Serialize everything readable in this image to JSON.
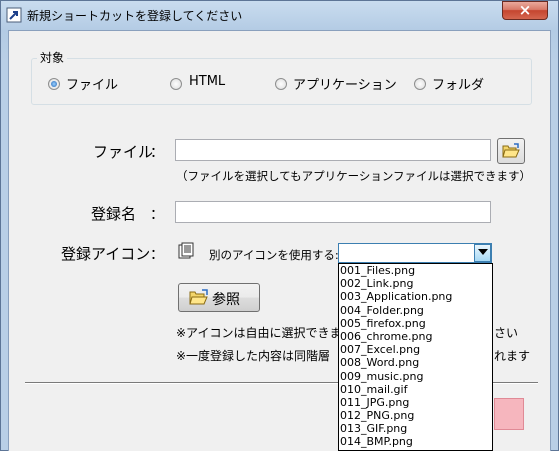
{
  "window": {
    "title": "新規ショートカットを登録してください",
    "close_label": "×"
  },
  "target_group": {
    "legend": "対象",
    "options": [
      {
        "label": "ファイル",
        "checked": true
      },
      {
        "label": "HTML",
        "checked": false
      },
      {
        "label": "アプリケーション",
        "checked": false
      },
      {
        "label": "フォルダ",
        "checked": false
      }
    ]
  },
  "file_field": {
    "label": "ファイル",
    "colon": "：",
    "value": "",
    "hint": "（ファイルを選択してもアプリケーションファイルは選択できます）"
  },
  "name_field": {
    "label": "登録名",
    "colon": "：",
    "value": ""
  },
  "icon_field": {
    "label": "登録アイコン",
    "colon": "：",
    "use_other_label": "別のアイコンを使用する:",
    "selected_value": ""
  },
  "reference_button": {
    "label": "参照"
  },
  "notes": {
    "line1_left": "※アイコンは自由に選択できます",
    "line1_right": "さい",
    "line2_left": "※一度登録した内容は同階層",
    "line2_right": "れます"
  },
  "icon_dropdown": {
    "items": [
      "001_Files.png",
      "002_Link.png",
      "003_Application.png",
      "004_Folder.png",
      "005_firefox.png",
      "006_chrome.png",
      "007_Excel.png",
      "008_Word.png",
      "009_music.png",
      "010_mail.gif",
      "011_JPG.png",
      "012_PNG.png",
      "013_GIF.png",
      "014_BMP.png"
    ]
  },
  "colors": {
    "frame": "#bcd3ea",
    "client_bg": "#f0f0f0",
    "close_button": "#c5452f",
    "pink_button": "#f6b6be"
  }
}
